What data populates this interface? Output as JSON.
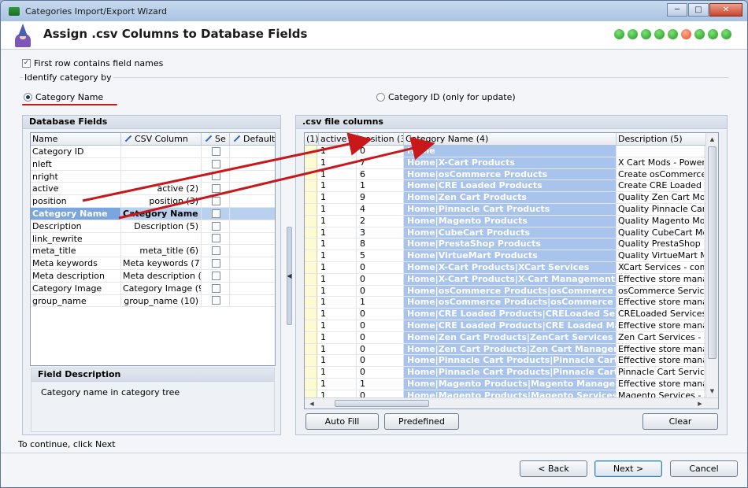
{
  "window": {
    "title": "Categories Import/Export Wizard"
  },
  "header": {
    "title": "Assign .csv Columns to Database Fields",
    "steps": [
      0,
      0,
      0,
      0,
      0,
      1,
      0,
      0,
      0
    ]
  },
  "options": {
    "first_row_label": "First row contains field names",
    "first_row_checked": true,
    "identify_label": "Identify category by",
    "radio_name_label": "Category Name",
    "radio_id_label": "Category ID (only for update)",
    "selected_radio": "name"
  },
  "db_panel": {
    "title": "Database Fields",
    "columns": {
      "name": "Name",
      "csv": "CSV Column",
      "se": "Se",
      "default": "Default"
    },
    "rows": [
      {
        "name": "Category ID",
        "csv": ""
      },
      {
        "name": "nleft",
        "csv": ""
      },
      {
        "name": "nright",
        "csv": ""
      },
      {
        "name": "active",
        "csv": "active (2)"
      },
      {
        "name": "position",
        "csv": "position (3)"
      },
      {
        "name": "Category Name",
        "csv": "Category Name (4",
        "selected": true
      },
      {
        "name": "Description",
        "csv": "Description (5)"
      },
      {
        "name": "link_rewrite",
        "csv": ""
      },
      {
        "name": "meta_title",
        "csv": "meta_title (6)"
      },
      {
        "name": "Meta keywords",
        "csv": "Meta keywords (7)"
      },
      {
        "name": "Meta description",
        "csv": "Meta description (8)"
      },
      {
        "name": "Category Image",
        "csv": "Category Image (9)"
      },
      {
        "name": "group_name",
        "csv": "group_name (10)"
      }
    ]
  },
  "field_description": {
    "title": "Field Description",
    "text": "Category name in category tree"
  },
  "csv_panel": {
    "title": ".csv file columns",
    "columns": [
      "(1)",
      "active (2)",
      "position (3)",
      "Category Name (4)",
      "Description (5)"
    ],
    "rows": [
      [
        "1",
        "0",
        "Home",
        ""
      ],
      [
        "1",
        "7",
        "Home|X-Cart Products",
        "X Cart Mods - Powerfull"
      ],
      [
        "1",
        "6",
        "Home|osCommerce Products",
        "Create osCommerce Dat"
      ],
      [
        "1",
        "1",
        "Home|CRE Loaded Products",
        "Create CRE Loaded Dat"
      ],
      [
        "1",
        "9",
        "Home|Zen Cart Products",
        "Quality Zen Cart Module"
      ],
      [
        "1",
        "4",
        "Home|Pinnacle Cart Products",
        "Quality Pinnacle Cart Mo"
      ],
      [
        "1",
        "2",
        "Home|Magento Products",
        "Quality Magento Module"
      ],
      [
        "1",
        "3",
        "Home|CubeCart Products",
        "Quality CubeCart Modul"
      ],
      [
        "1",
        "8",
        "Home|PrestaShop Products",
        "Quality PrestaShop Mod"
      ],
      [
        "1",
        "5",
        "Home|VirtueMart Products",
        "Quality VirtueMart Modu"
      ],
      [
        "1",
        "0",
        "Home|X-Cart Products|XCart Services",
        "XCart Services - comme"
      ],
      [
        "1",
        "0",
        "Home|X-Cart Products|X-Cart Management",
        "Effective store manager"
      ],
      [
        "1",
        "0",
        "Home|osCommerce Products|osCommerce Serv",
        "osCommerce Services -"
      ],
      [
        "1",
        "1",
        "Home|osCommerce Products|osCommerce Mar",
        "Effective store manager"
      ],
      [
        "1",
        "0",
        "Home|CRE Loaded Products|CRELoaded Service",
        "CRELoaded Services - co"
      ],
      [
        "1",
        "0",
        "Home|CRE Loaded Products|CRE Loaded Manag",
        "Effective store manager"
      ],
      [
        "1",
        "0",
        "Home|Zen Cart Products|ZenCart Services",
        "Zen Cart Services - com"
      ],
      [
        "1",
        "0",
        "Home|Zen Cart Products|Zen Cart Management",
        "Effective store manager"
      ],
      [
        "1",
        "0",
        "Home|Pinnacle Cart Products|Pinnacle Cart Mar",
        "Effective store manager"
      ],
      [
        "1",
        "0",
        "Home|Pinnacle Cart Products|Pinnacle Cart Serv",
        "Pinnacle Cart Services -"
      ],
      [
        "1",
        "1",
        "Home|Magento Products|Magento Management",
        "Effective store manager"
      ],
      [
        "1",
        "0",
        "Home|Magento Products|Magento Services",
        "Magento Services - com"
      ]
    ]
  },
  "buttons": {
    "auto_fill": "Auto Fill",
    "predefined": "Predefined",
    "clear": "Clear",
    "back": "< Back",
    "next": "Next >",
    "cancel": "Cancel"
  },
  "footer": {
    "hint": "To continue, click Next"
  }
}
